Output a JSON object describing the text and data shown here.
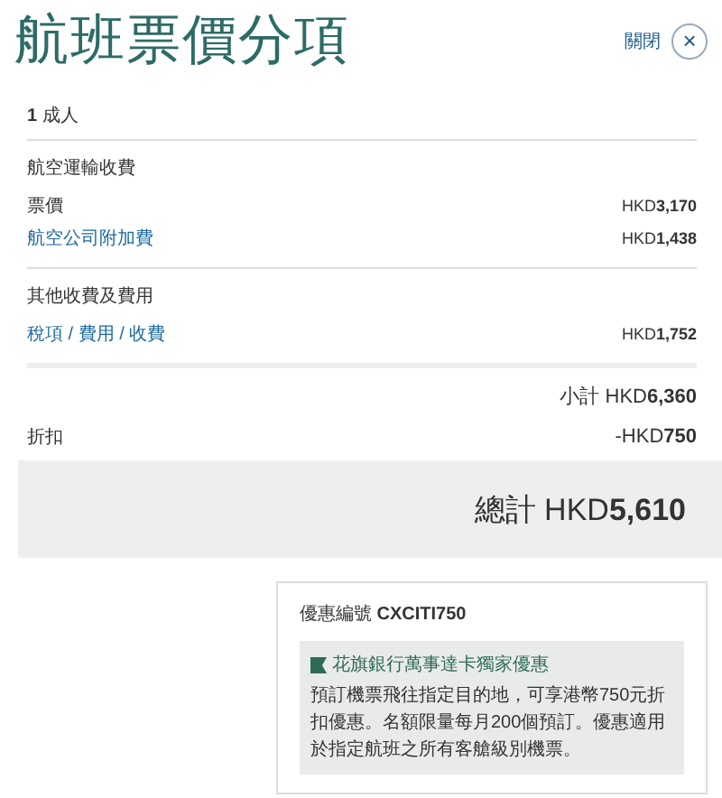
{
  "title": "航班票價分項",
  "close": {
    "label": "關閉",
    "icon": "×"
  },
  "passengers": "**1** 成人",
  "sections": [
    {
      "heading": "航空運輸收費",
      "rows": [
        {
          "label": "票價",
          "link": false,
          "amount": "HKD**3,170**"
        },
        {
          "label": "航空公司附加費",
          "link": true,
          "amount": "HKD**1,438**"
        }
      ]
    },
    {
      "heading": "其他收費及費用",
      "rows": [
        {
          "label": "稅項 / 費用 / 收費",
          "link": true,
          "amount": "HKD**1,752**"
        }
      ]
    }
  ],
  "subtotal": "小計 HKD**6,360**",
  "discount": {
    "label": "折扣",
    "amount": "-HKD**750**"
  },
  "total": "總計 HKD**5,610**",
  "promo": {
    "code": "優惠編號 **CXCITI750**",
    "title": "花旗銀行萬事達卡獨家優惠",
    "text": "預訂機票飛往指定目的地，可享港幣750元折扣優惠。名額限量每月200個預訂。優惠適用於指定航班之所有客艙級別機票。"
  }
}
